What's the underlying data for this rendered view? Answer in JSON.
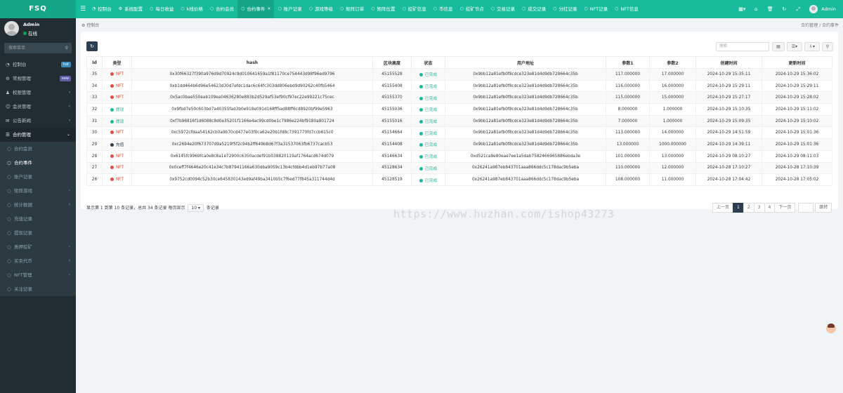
{
  "brand": "FSQ",
  "tabs": [
    {
      "label": "控制台",
      "icon": "dashboard-icon"
    },
    {
      "label": "系统配置",
      "icon": "cog-icon"
    },
    {
      "label": "每日收益",
      "icon": "circle-icon"
    },
    {
      "label": "k线价格",
      "icon": "circle-icon"
    },
    {
      "label": "合约会员",
      "icon": "circle-icon"
    },
    {
      "label": "合约事件",
      "icon": "circle-icon",
      "active": true
    },
    {
      "label": "账户记录",
      "icon": "circle-icon"
    },
    {
      "label": "游戏等级",
      "icon": "circle-icon"
    },
    {
      "label": "矩阵订单",
      "icon": "circle-icon"
    },
    {
      "label": "矩阵位置",
      "icon": "circle-icon"
    },
    {
      "label": "挖矿信息",
      "icon": "circle-icon"
    },
    {
      "label": "币信息",
      "icon": "circle-icon"
    },
    {
      "label": "挖矿节点",
      "icon": "circle-icon"
    },
    {
      "label": "交易记录",
      "icon": "circle-icon"
    },
    {
      "label": "成交记录",
      "icon": "circle-icon"
    },
    {
      "label": "分红记录",
      "icon": "circle-icon"
    },
    {
      "label": "NFT记录",
      "icon": "circle-icon"
    },
    {
      "label": "NFT信息",
      "icon": "circle-icon"
    }
  ],
  "user": {
    "name": "Admin",
    "status": "在线"
  },
  "sidebar": {
    "search_placeholder": "搜索菜单",
    "items": [
      {
        "label": "控制台",
        "icon": "dashboard-icon",
        "badge": "hot",
        "badge_color": "#3c8dbc"
      },
      {
        "label": "常规管理",
        "icon": "cog-icon",
        "badge": "new",
        "badge_color": "#605ca8"
      },
      {
        "label": "权限管理",
        "icon": "group-icon",
        "arrow": true
      },
      {
        "label": "会员管理",
        "icon": "user-icon",
        "arrow": true
      },
      {
        "label": "公告新闻",
        "icon": "news-icon",
        "arrow": true
      },
      {
        "label": "合约管理",
        "icon": "list-icon",
        "arrow": true,
        "open": true
      }
    ],
    "sub_items": [
      {
        "label": "合约会员",
        "icon": "circle-icon"
      },
      {
        "label": "合约事件",
        "icon": "circle-icon",
        "active": true
      },
      {
        "label": "账户记录",
        "icon": "circle-icon"
      },
      {
        "label": "矩阵游戏",
        "icon": "circle-icon",
        "arrow": true
      },
      {
        "label": "统计数据",
        "icon": "circle-icon",
        "arrow": true
      },
      {
        "label": "充值记录",
        "icon": "circle-icon"
      },
      {
        "label": "提现记录",
        "icon": "circle-icon"
      },
      {
        "label": "质押挖矿",
        "icon": "circle-icon",
        "arrow": true
      },
      {
        "label": "买卖代币",
        "icon": "circle-icon",
        "arrow": true
      },
      {
        "label": "NFT管理",
        "icon": "circle-icon",
        "arrow": true
      },
      {
        "label": "关注记录",
        "icon": "circle-icon"
      }
    ]
  },
  "breadcrumb": {
    "home": "控制台",
    "path": "合约管理 / 合约事件"
  },
  "toolbar": {
    "search_placeholder": "搜索"
  },
  "table": {
    "headers": [
      "Id",
      "类型",
      "hash",
      "区块高度",
      "状态",
      "用户地址",
      "参数1",
      "参数2",
      "创建时间",
      "更新时间"
    ],
    "rows": [
      {
        "id": "35",
        "type": "NFT",
        "type_color": "#e74c3c",
        "hash": "0x30f66327f390a976d9d70924c9d010641659a1f81170ce754443d98f96ed9796",
        "block": "45155528",
        "status": "已完成",
        "addr": "0x9bb12a81efb0f8cdce323e81d4d9db728664c35b",
        "p1": "117.000000",
        "p2": "17.000000",
        "created": "2024-10-29 15:35:11",
        "updated": "2024-10-29 15:36:02"
      },
      {
        "id": "34",
        "type": "NFT",
        "type_color": "#e74c3c",
        "hash": "0xb1dd464b6d96e54623d30d7efdc1dac6c64fc303dd806ebd9d90262c40fb5464",
        "block": "45155408",
        "status": "已完成",
        "addr": "0x9bb12a81efb0f8cdce323e81d4d9db728664c35b",
        "p1": "116.000000",
        "p2": "16.000000",
        "created": "2024-10-29 15:29:11",
        "updated": "2024-10-29 15:29:11"
      },
      {
        "id": "33",
        "type": "NFT",
        "type_color": "#e74c3c",
        "hash": "0x5ac0bae550eab109ea04636280e883b2d529af53ef90cf97ec22e99221c75cec",
        "block": "45155370",
        "status": "已完成",
        "addr": "0x9bb12a81efb0f8cdce323e81d4d9db728664c35b",
        "p1": "115.000000",
        "p2": "15.000000",
        "created": "2024-10-29 15:27:17",
        "updated": "2024-10-29 15:28:02"
      },
      {
        "id": "32",
        "type": "提现",
        "type_color": "#18bc9c",
        "hash": "0x9fbd7e50c603bd7a40355fad3b0e918e091d168ff5ad88ff6cd8920bf99e5963",
        "block": "45155036",
        "status": "已完成",
        "addr": "0x9bb12a81efb0f8cdce323e81d4d9db728664c35b",
        "p1": "8.000000",
        "p2": "1.000000",
        "created": "2024-10-29 15:10:35",
        "updated": "2024-10-29 15:11:02"
      },
      {
        "id": "31",
        "type": "提现",
        "type_color": "#18bc9c",
        "hash": "0xf7b96816f1d6088c8d0e35201f1166e4ac99cd0be1c7986e224bf9180a801724",
        "block": "45155016",
        "status": "已完成",
        "addr": "0x9bb12a81efb0f8cdce323e81d4d9db728664c35b",
        "p1": "7.000000",
        "p2": "1.000000",
        "created": "2024-10-29 15:09:35",
        "updated": "2024-10-29 15:10:02"
      },
      {
        "id": "30",
        "type": "NFT",
        "type_color": "#e74c3c",
        "hash": "0xc5972cfdaa54162cb0a9b70cd477e03f0ca62e20b1fd8c7391770fd7ccb615c0",
        "block": "45154664",
        "status": "已完成",
        "addr": "0x9bb12a81efb0f8cdce323e81d4d9db728664c35b",
        "p1": "113.000000",
        "p2": "14.000000",
        "created": "2024-10-29 14:51:59",
        "updated": "2024-10-29 15:01:36"
      },
      {
        "id": "29",
        "type": "充值",
        "type_color": "#2c3e50",
        "hash": "0xc2694e20f673707d9a5219f5f2c94b2ff649b8d67f3a31537063fb6737cacb53",
        "block": "45154408",
        "status": "已完成",
        "addr": "0x9bb12a81efb0f8cdce323e81d4d9db728664c35b",
        "p1": "13.000000",
        "p2": "1000.000000",
        "created": "2024-10-29 14:39:11",
        "updated": "2024-10-29 15:01:36"
      },
      {
        "id": "28",
        "type": "NFT",
        "type_color": "#e74c3c",
        "hash": "0x6145fc9969fca0e8c8a1e72900c6350acdef91b038820119af1764acd674d079",
        "block": "45146634",
        "status": "已完成",
        "addr": "0xd521ca9e80eae7ee1a5dab7582466965886ebda3e",
        "p1": "101.000000",
        "p2": "13.000000",
        "created": "2024-10-29 08:10:27",
        "updated": "2024-10-29 08:11:03"
      },
      {
        "id": "27",
        "type": "NFT",
        "type_color": "#e74c3c",
        "hash": "0x0ceff7f4646e20c41e34c7b87941166a630dba9059c13b4cfdbb4d1eb97b77a08",
        "block": "45128634",
        "status": "已完成",
        "addr": "0x26241a987eb843701aaa866ddc5c178dac9b5eba",
        "p1": "110.000000",
        "p2": "12.000000",
        "created": "2024-10-28 17:10:27",
        "updated": "2024-10-28 17:10:39"
      },
      {
        "id": "26",
        "type": "NFT",
        "type_color": "#e74c3c",
        "hash": "0x9752cd0094c52b30ce845830143ed9af49ba3410b5c7f6ed77f845a311744d4d",
        "block": "45128519",
        "status": "已完成",
        "addr": "0x26241a987eb843701aaa866ddc5c178dac9b5eba",
        "p1": "108.000000",
        "p2": "11.000000",
        "created": "2024-10-28 17:04:42",
        "updated": "2024-10-28 17:05:02"
      }
    ]
  },
  "footer": {
    "info_prefix": "显示第 1 到第 10 条记录，总共 34 条记录 每页显示",
    "page_size": "10",
    "info_suffix": "条记录"
  },
  "pager": {
    "prev": "上一页",
    "pages": [
      "1",
      "2",
      "3",
      "4"
    ],
    "active": "1",
    "next": "下一页",
    "go": "跳转"
  },
  "watermark": "https://www.huzhan.com/ishop43273"
}
